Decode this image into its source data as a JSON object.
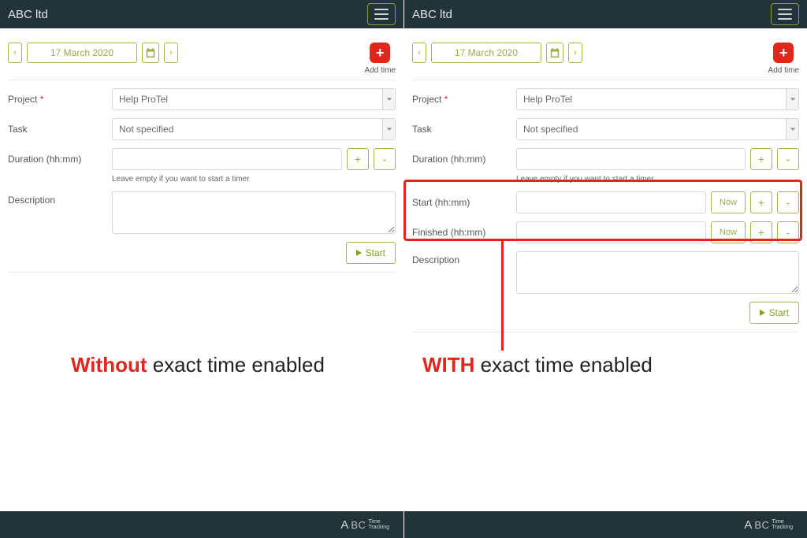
{
  "brand": "ABC ltd",
  "date": "17 March 2020",
  "nav_prev": "‹",
  "nav_next": "›",
  "add_time_label": "Add time",
  "fields": {
    "project_label": "Project",
    "project_value": "Help ProTel",
    "task_label": "Task",
    "task_value": "Not specified",
    "duration_label": "Duration (hh:mm)",
    "duration_hint": "Leave empty if you want to start a timer",
    "start_label": "Start (hh:mm)",
    "finished_label": "Finished (hh:mm)",
    "description_label": "Description",
    "now": "Now",
    "plus": "+",
    "minus": "-"
  },
  "start_button": "Start",
  "footer_logo": {
    "a": "A",
    "bc": "BC",
    "tt1": "Time",
    "tt2": "Tracking"
  },
  "captions": {
    "left_red": "Without",
    "left_rest": " exact time enabled",
    "right_red": "WITH",
    "right_rest": " exact time enabled"
  }
}
